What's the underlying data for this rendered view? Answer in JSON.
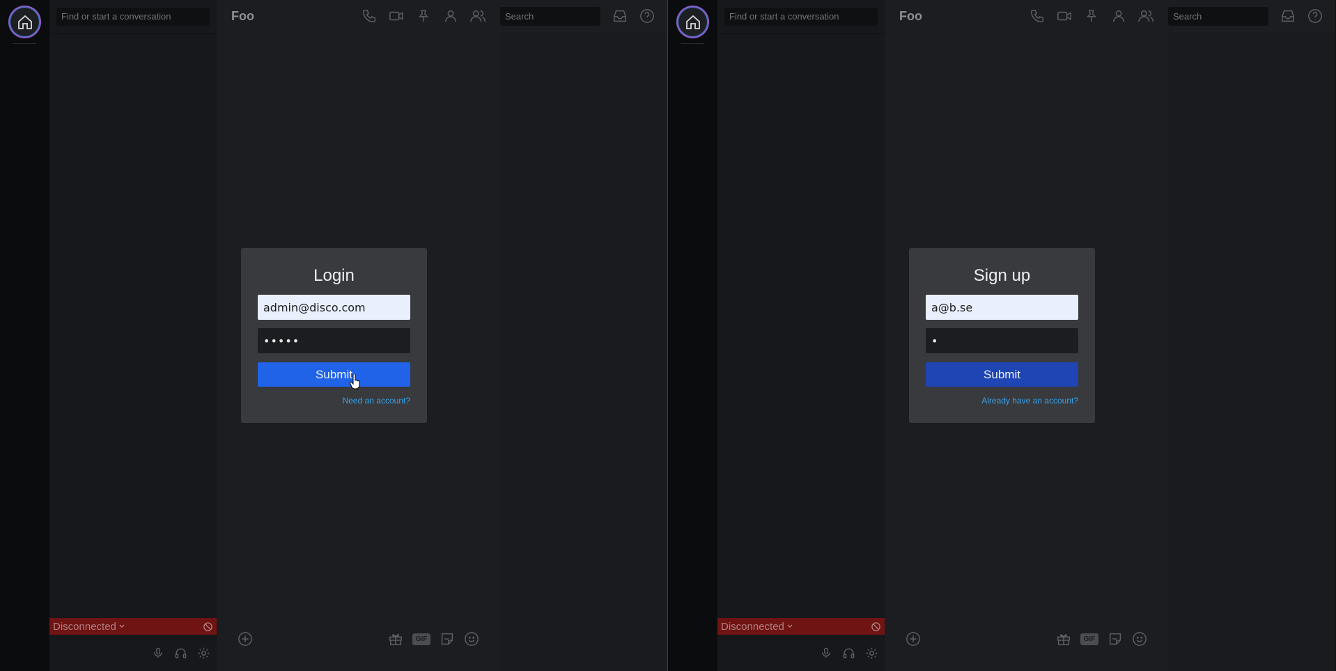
{
  "left": {
    "sidebar": {
      "search_placeholder": "Find or start a conversation",
      "status": "Disconnected"
    },
    "header": {
      "channel": "Foo",
      "search_placeholder": "Search"
    },
    "modal": {
      "title": "Login",
      "email": "admin@disco.com",
      "password": "•••••",
      "submit": "Submit",
      "switch_link": "Need an account?"
    }
  },
  "right": {
    "sidebar": {
      "search_placeholder": "Find or start a conversation",
      "status": "Disconnected"
    },
    "header": {
      "channel": "Foo",
      "search_placeholder": "Search"
    },
    "modal": {
      "title": "Sign up",
      "email": "a@b.se",
      "password": "•",
      "submit": "Submit",
      "switch_link": "Already have an account?"
    }
  },
  "composer": {
    "gif_label": "GIF"
  },
  "icons": [
    "home-icon",
    "phone-icon",
    "video-icon",
    "pin-icon",
    "user-icon",
    "users-icon",
    "inbox-icon",
    "help-icon",
    "mic-icon",
    "headphones-icon",
    "gear-icon",
    "add-icon",
    "gift-icon",
    "sticker-icon",
    "emoji-icon",
    "block-icon",
    "chevron-down-icon"
  ],
  "colors": {
    "accent": "#2062e8",
    "status_disconnected": "#6f1313",
    "link": "#36a4ee"
  }
}
